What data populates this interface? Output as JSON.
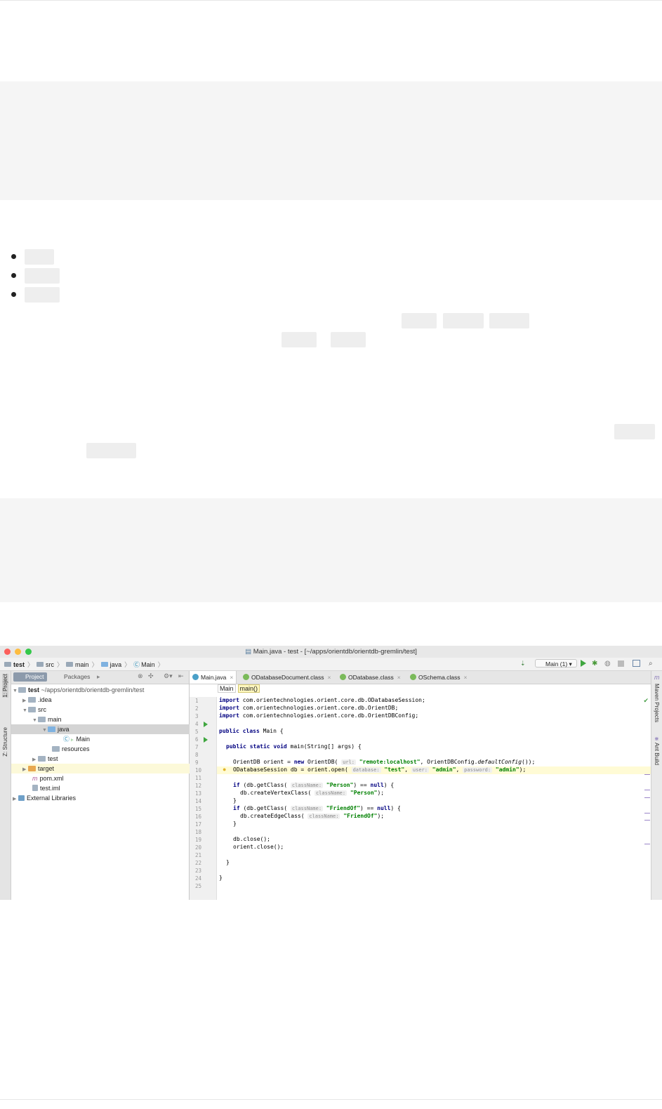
{
  "ide": {
    "window_title": "Main.java - test - [~/apps/orientdb/orientdb-gremlin/test]",
    "breadcrumbs": [
      "test",
      "src",
      "main",
      "java",
      "Main"
    ],
    "run_config": "Main (1)",
    "left_strip": {
      "project": "1: Project",
      "structure": "Z: Structure"
    },
    "right_strip": {
      "maven": "Maven Projects",
      "ant": "Ant Build"
    },
    "project_tabs": {
      "project": "Project",
      "packages": "Packages"
    },
    "tree": [
      {
        "label": "test",
        "suffix": "~/apps/orientdb/orientdb-gremlin/test"
      },
      {
        "label": ".idea"
      },
      {
        "label": "src"
      },
      {
        "label": "main"
      },
      {
        "label": "java"
      },
      {
        "label": "Main"
      },
      {
        "label": "resources"
      },
      {
        "label": "test"
      },
      {
        "label": "target"
      },
      {
        "label": "pom.xml"
      },
      {
        "label": "test.iml"
      },
      {
        "label": "External Libraries"
      }
    ],
    "editor_tabs": [
      "Main.java",
      "ODatabaseDocument.class",
      "ODatabase.class",
      "OSchema.class"
    ],
    "editor_crumbs": [
      "Main",
      "main()"
    ],
    "code": {
      "l1_kw": "import",
      "l1": " com.orientechnologies.orient.core.db.ODatabaseSession;",
      "l2_kw": "import",
      "l2": " com.orientechnologies.orient.core.db.OrientDB;",
      "l3_kw": "import",
      "l3": " com.orientechnologies.orient.core.db.OrientDBConfig;",
      "l5_kw": "public class",
      "l5": " Main {",
      "l7_kw": "public static void",
      "l7": " main(String[] args) {",
      "l9_a": "OrientDB orient = ",
      "l9_kw": "new",
      "l9_b": " OrientDB( ",
      "l9_hint": "url:",
      "l9_str": "\"remote:localhost\"",
      "l9_c": ", OrientDBConfig.",
      "l9_d": "defaultConfig",
      "l9_e": "());",
      "l10_a": "ODatabaseSession db = orient.open( ",
      "l10_h1": "database:",
      "l10_s1": "\"test\"",
      "l10_h2": "user:",
      "l10_s2": "\"admin\"",
      "l10_h3": "password:",
      "l10_s3": "\"admin\"",
      "l10_e": ");",
      "l12_kw": "if",
      "l12_a": " (db.getClass( ",
      "l12_hint": "className:",
      "l12_str": "\"Person\"",
      "l12_b": ") == ",
      "l12_kw2": "null",
      "l12_c": ") {",
      "l13_a": "db.createVertexClass( ",
      "l13_hint": "className:",
      "l13_str": "\"Person\"",
      "l13_b": ");",
      "l14": "}",
      "l15_kw": "if",
      "l15_a": " (db.getClass( ",
      "l15_hint": "className:",
      "l15_str": "\"FriendOf\"",
      "l15_b": ") == ",
      "l15_kw2": "null",
      "l15_c": ") {",
      "l16_a": "db.createEdgeClass( ",
      "l16_hint": "className:",
      "l16_str": "\"FriendOf\"",
      "l16_b": ");",
      "l17": "}",
      "l19": "db.close();",
      "l20": "orient.close();",
      "l22": "}",
      "l24": "}"
    },
    "line_numbers": [
      "1",
      "2",
      "3",
      "4",
      "5",
      "6",
      "7",
      "8",
      "9",
      "10",
      "11",
      "12",
      "13",
      "14",
      "15",
      "16",
      "17",
      "18",
      "19",
      "20",
      "21",
      "22",
      "23",
      "24",
      "25"
    ]
  }
}
